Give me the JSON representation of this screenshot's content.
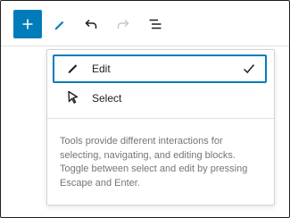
{
  "toolbar": {
    "inserter": {
      "icon": "plus-icon",
      "label": "Add block"
    },
    "tools": {
      "icon": "pencil-icon",
      "label": "Tools"
    },
    "undo": {
      "icon": "undo-icon",
      "label": "Undo"
    },
    "redo": {
      "icon": "redo-icon",
      "label": "Redo"
    },
    "list_view": {
      "icon": "list-view-icon",
      "label": "Document overview"
    }
  },
  "tools_menu": {
    "items": [
      {
        "label": "Edit",
        "icon": "pencil-icon",
        "selected": true
      },
      {
        "label": "Select",
        "icon": "pointer-icon",
        "selected": false
      }
    ],
    "help_text": "Tools provide different interactions for selecting, navigating, and editing blocks. Toggle between select and edit by pressing Escape and Enter."
  },
  "colors": {
    "accent": "#007cba",
    "text": "#1e1e1e",
    "muted": "#757575",
    "disabled": "#c8c8c8"
  }
}
